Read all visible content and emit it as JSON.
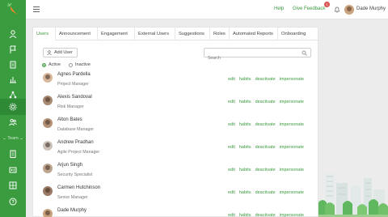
{
  "topbar": {
    "help": "Help",
    "feedback": "Give Feedback",
    "feedback_badge": "1",
    "user_name": "Dade Murphy"
  },
  "sidebar": {
    "divider_label": "Team"
  },
  "tabs": [
    "Users",
    "Announcement",
    "Engagement",
    "External Users",
    "Suggestions",
    "Roles",
    "Automated Reports",
    "Onboarding"
  ],
  "toolbar": {
    "add_user": "Add User",
    "search_placeholder": "Search"
  },
  "filters": {
    "active": "Active",
    "inactive": "Inactive"
  },
  "users": [
    {
      "name": "Agnes Pardella",
      "role": "Project Manager"
    },
    {
      "name": "Alexis Sandoval",
      "role": "Risk Manager"
    },
    {
      "name": "Alton Bates",
      "role": "Database Manager"
    },
    {
      "name": "Andrew Pradhan",
      "role": "Agile Project Manager"
    },
    {
      "name": "Arjun Singh",
      "role": "Security Specialist"
    },
    {
      "name": "Carmen Hutchinson",
      "role": "Senior Manager"
    },
    {
      "name": "Dade Murphy",
      "role": ""
    }
  ],
  "row_actions": {
    "edit": "edit",
    "habits": "habits",
    "deactivate": "deactivate",
    "impersonate": "impersonate"
  },
  "colors": {
    "brand": "#3a9b3f",
    "badge": "#d9534f"
  }
}
